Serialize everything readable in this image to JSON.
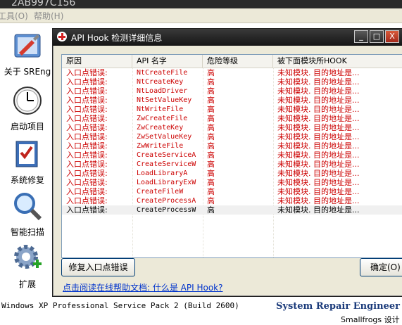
{
  "background_app": {
    "title": "2AB997C156",
    "menu": [
      "工具(O)",
      "帮助(H)"
    ],
    "sidebar": [
      {
        "label": "关于 SREng",
        "icon": "tools-icon"
      },
      {
        "label": "启动项目",
        "icon": "clock-icon"
      },
      {
        "label": "系统修复",
        "icon": "checklist-icon"
      },
      {
        "label": "智能扫描",
        "icon": "magnifier-icon"
      },
      {
        "label": "扩展",
        "icon": "gear-plus-icon"
      }
    ],
    "status": {
      "os": "Windows XP Professional Service Pack 2 (Build 2600)",
      "brand": "System Repair Engineer",
      "brand_sub": "Smallfrogs 设计"
    }
  },
  "dialog": {
    "title": "API Hook 检测详细信息",
    "columns": [
      "原因",
      "API 名字",
      "危险等级",
      "被下面模块所HOOK"
    ],
    "rows": [
      {
        "reason": "入口点错误:",
        "api": "NtCreateFile",
        "risk": "高",
        "module": "未知模块. 目的地址是..."
      },
      {
        "reason": "入口点错误:",
        "api": "NtCreateKey",
        "risk": "高",
        "module": "未知模块. 目的地址是..."
      },
      {
        "reason": "入口点错误:",
        "api": "NtLoadDriver",
        "risk": "高",
        "module": "未知模块. 目的地址是..."
      },
      {
        "reason": "入口点错误:",
        "api": "NtSetValueKey",
        "risk": "高",
        "module": "未知模块. 目的地址是..."
      },
      {
        "reason": "入口点错误:",
        "api": "NtWriteFile",
        "risk": "高",
        "module": "未知模块. 目的地址是..."
      },
      {
        "reason": "入口点错误:",
        "api": "ZwCreateFile",
        "risk": "高",
        "module": "未知模块. 目的地址是..."
      },
      {
        "reason": "入口点错误:",
        "api": "ZwCreateKey",
        "risk": "高",
        "module": "未知模块. 目的地址是..."
      },
      {
        "reason": "入口点错误:",
        "api": "ZwSetValueKey",
        "risk": "高",
        "module": "未知模块. 目的地址是..."
      },
      {
        "reason": "入口点错误:",
        "api": "ZwWriteFile",
        "risk": "高",
        "module": "未知模块. 目的地址是..."
      },
      {
        "reason": "入口点错误:",
        "api": "CreateServiceA",
        "risk": "高",
        "module": "未知模块. 目的地址是..."
      },
      {
        "reason": "入口点错误:",
        "api": "CreateServiceW",
        "risk": "高",
        "module": "未知模块. 目的地址是..."
      },
      {
        "reason": "入口点错误:",
        "api": "LoadLibraryA",
        "risk": "高",
        "module": "未知模块. 目的地址是..."
      },
      {
        "reason": "入口点错误:",
        "api": "LoadLibraryExW",
        "risk": "高",
        "module": "未知模块. 目的地址是..."
      },
      {
        "reason": "入口点错误:",
        "api": "CreateFileW",
        "risk": "高",
        "module": "未知模块. 目的地址是..."
      },
      {
        "reason": "入口点错误:",
        "api": "CreateProcessA",
        "risk": "高",
        "module": "未知模块. 目的地址是..."
      },
      {
        "reason": "入口点错误:",
        "api": "CreateProcessW",
        "risk": "高",
        "module": "未知模块. 目的地址是...",
        "selected": true
      }
    ],
    "repair_button": "修复入口点错误",
    "ok_button": "确定(O)",
    "help_link": "点击阅读在线帮助文档: 什么是 API Hook?",
    "window_buttons": {
      "minimize": "_",
      "maximize": "□",
      "close": "X"
    },
    "colors": {
      "error_row": "#cc0000",
      "selected_row_text": "#000000",
      "title_bar": "#1e1e1e",
      "link": "#0033cc"
    }
  }
}
